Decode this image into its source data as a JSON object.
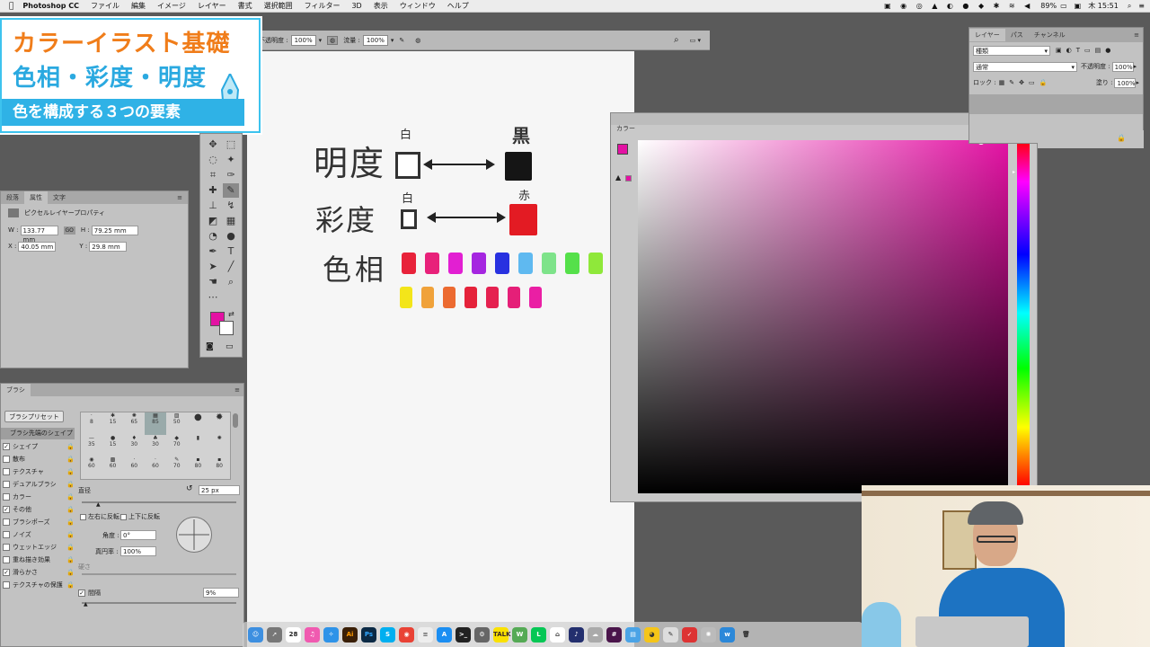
{
  "menubar": {
    "app": "Photoshop CC",
    "items": [
      "ファイル",
      "編集",
      "イメージ",
      "レイヤー",
      "書式",
      "選択範囲",
      "フィルター",
      "3D",
      "表示",
      "ウィンドウ",
      "ヘルプ"
    ],
    "battery": "89%",
    "clock": "木 15:51"
  },
  "options": {
    "opacity_label": "不透明度 :",
    "opacity": "100%",
    "flow_label": "流量 :",
    "flow": "100%"
  },
  "title_card": {
    "line1": "カラーイラスト基礎",
    "line2": "色相・彩度・明度",
    "subtitle": "色を構成する３つの要素"
  },
  "properties": {
    "tabs": [
      "段落",
      "属性",
      "文字"
    ],
    "title": "ピクセルレイヤープロパティ",
    "w_label": "W :",
    "w": "133.77 mm",
    "link": "GO",
    "h_label": "H :",
    "h": "79.25 mm",
    "x_label": "X :",
    "x": "40.05 mm",
    "y_label": "Y :",
    "y": "29.8 mm"
  },
  "brush_panel": {
    "tab": "ブラシ",
    "preset_button": "ブラシプリセット",
    "tip_shape": "ブラシ先端のシェイプ",
    "options": [
      {
        "label": "シェイプ",
        "checked": true
      },
      {
        "label": "散布",
        "checked": false
      },
      {
        "label": "テクスチャ",
        "checked": false
      },
      {
        "label": "デュアルブラシ",
        "checked": false
      },
      {
        "label": "カラー",
        "checked": false
      },
      {
        "label": "その他",
        "checked": true
      },
      {
        "label": "ブラシポーズ",
        "checked": false
      },
      {
        "label": "ノイズ",
        "checked": false
      },
      {
        "label": "ウェットエッジ",
        "checked": false
      },
      {
        "label": "重ね描き効果",
        "checked": false
      },
      {
        "label": "滑らかさ",
        "checked": true
      },
      {
        "label": "テクスチャの保護",
        "checked": false
      }
    ],
    "brush_sizes": [
      "8",
      "15",
      "65",
      "85",
      "50",
      "",
      "",
      "35",
      "15",
      "30",
      "30",
      "70",
      "",
      "",
      "",
      "60",
      "60",
      "60",
      "60",
      "70",
      "80",
      "80",
      "25"
    ],
    "size_label": "直径",
    "size": "25 px",
    "flip_x": "左右に反転",
    "flip_y": "上下に反転",
    "angle_label": "角度 :",
    "angle": "0°",
    "roundness_label": "真円率 :",
    "roundness": "100%",
    "hardness_label": "硬さ",
    "spacing_label": "間隔",
    "spacing": "9%"
  },
  "canvas_text": {
    "row1": "明度",
    "row2": "彩度",
    "row3": "色相",
    "white1": "白",
    "black": "黒",
    "white2": "白",
    "red": "赤"
  },
  "hue_swatches_row1": [
    "#e8223a",
    "#e8217a",
    "#e21fd2",
    "#a526e0",
    "#2831e0",
    "#5fb9f0",
    "#7ee38a",
    "#55e04a",
    "#8fe83a"
  ],
  "hue_swatches_row2": [
    "#f3e51a",
    "#f0a23a",
    "#ec6a30",
    "#e5223a",
    "#e52150",
    "#e51f78",
    "#ea1fa4"
  ],
  "color_panel": {
    "tab": "カラー",
    "fg": "#e312a3",
    "bg": "#ffffff"
  },
  "layers_panel": {
    "tabs": [
      "レイヤー",
      "パス",
      "チャンネル"
    ],
    "kind": "種類",
    "blend": "通常",
    "opacity_label": "不透明度 :",
    "opacity": "100%",
    "lock_label": "ロック :",
    "fill_label": "塗り :",
    "fill": "100%"
  },
  "tool_colors": {
    "fg": "#e312a3",
    "bg": "#ffffff"
  },
  "dock": {
    "calendar_day": "28"
  }
}
